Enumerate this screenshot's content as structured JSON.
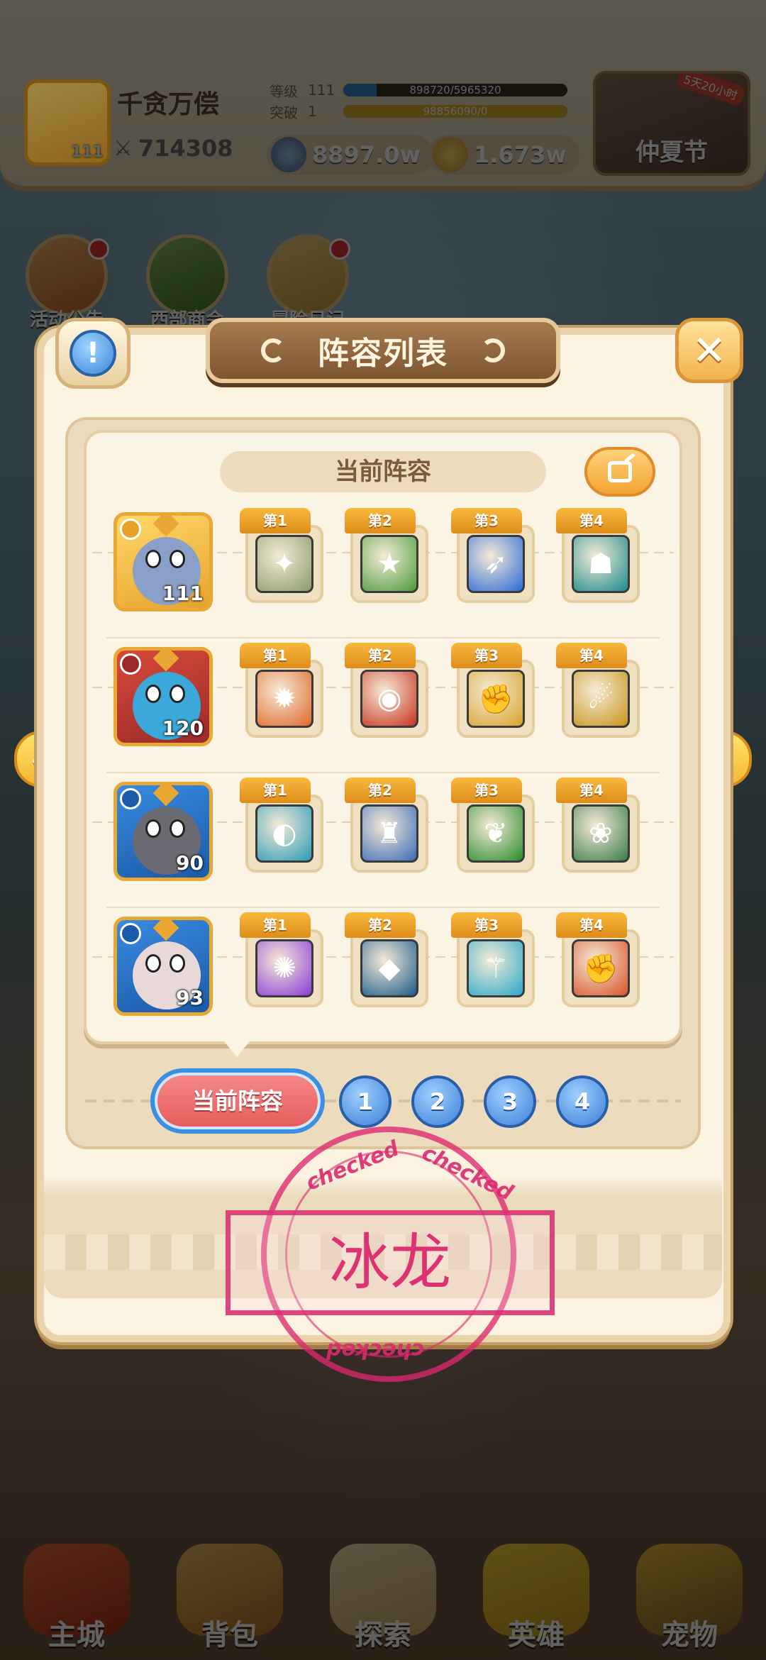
{
  "player": {
    "name": "千贪万偿",
    "level": "111",
    "power": "714308",
    "stats": [
      {
        "label": "等级",
        "value": "111",
        "progress_text": "898720/5965320",
        "progress": 0.15,
        "color": "#3c86c8"
      },
      {
        "label": "突破",
        "value": "1",
        "progress_text": "98856090/0",
        "progress": 1.0,
        "color": "#d9b32e"
      }
    ]
  },
  "currencies": [
    {
      "value": "8897.0w",
      "icon": "silver-coin-icon"
    },
    {
      "value": "1.673w",
      "icon": "gold-coin-icon"
    }
  ],
  "event": {
    "label": "仲夏节",
    "tag": "5天20小时"
  },
  "shortcuts": [
    {
      "label": "活动公告",
      "badge": true
    },
    {
      "label": "西部商会",
      "badge": false
    },
    {
      "label": "冒险日记",
      "badge": true
    }
  ],
  "modal": {
    "title": "阵容列表",
    "heading": "当前阵容",
    "info_icon": "!",
    "close_icon": "✕"
  },
  "lineup": [
    {
      "hero_level": "111",
      "hero_colors": [
        "#ffd86a",
        "#e7a22c"
      ],
      "face_color": "#8aa0c8",
      "skills": [
        {
          "tab": "第1",
          "color": "#8a9a6a",
          "glyph": "✦"
        },
        {
          "tab": "第2",
          "color": "#4a9a3a",
          "glyph": "★"
        },
        {
          "tab": "第3",
          "color": "#2a6ad8",
          "glyph": "➶"
        },
        {
          "tab": "第4",
          "color": "#1a8a8a",
          "glyph": "☗"
        }
      ]
    },
    {
      "hero_level": "120",
      "hero_colors": [
        "#d84a3a",
        "#9a2a2a"
      ],
      "face_color": "#3aa8d8",
      "skills": [
        {
          "tab": "第1",
          "color": "#e0662a",
          "glyph": "✹"
        },
        {
          "tab": "第2",
          "color": "#c8321e",
          "glyph": "◉"
        },
        {
          "tab": "第3",
          "color": "#d8a22a",
          "glyph": "✊"
        },
        {
          "tab": "第4",
          "color": "#c8941a",
          "glyph": "☄"
        }
      ]
    },
    {
      "hero_level": "90",
      "hero_colors": [
        "#3a8ae0",
        "#1a5aa8"
      ],
      "face_color": "#6a6a72",
      "skills": [
        {
          "tab": "第1",
          "color": "#2a9ab8",
          "glyph": "◐"
        },
        {
          "tab": "第2",
          "color": "#3a6ab8",
          "glyph": "♜"
        },
        {
          "tab": "第3",
          "color": "#2a8a2a",
          "glyph": "❦"
        },
        {
          "tab": "第4",
          "color": "#3a7a4a",
          "glyph": "❀"
        }
      ]
    },
    {
      "hero_level": "93",
      "hero_colors": [
        "#3a8ae0",
        "#1a5aa8"
      ],
      "face_color": "#e8d8d8",
      "skills": [
        {
          "tab": "第1",
          "color": "#8a3ad8",
          "glyph": "✺"
        },
        {
          "tab": "第2",
          "color": "#1a5a8a",
          "glyph": "◆"
        },
        {
          "tab": "第3",
          "color": "#2aa8c8",
          "glyph": "⚚"
        },
        {
          "tab": "第4",
          "color": "#d8522a",
          "glyph": "✊"
        }
      ]
    }
  ],
  "selector": {
    "current_label": "当前阵容",
    "pages": [
      "1",
      "2",
      "3",
      "4"
    ]
  },
  "nav": [
    {
      "label": "主城"
    },
    {
      "label": "背包"
    },
    {
      "label": "探索"
    },
    {
      "label": "英雄"
    },
    {
      "label": "宠物"
    }
  ],
  "stamp": {
    "text": "冰龙",
    "word": "checked"
  }
}
